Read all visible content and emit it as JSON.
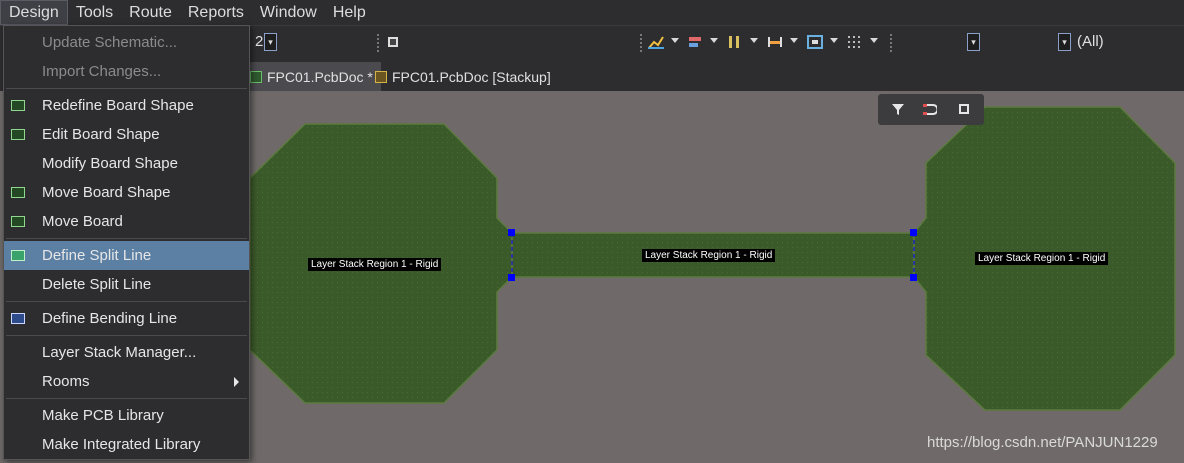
{
  "menubar": {
    "items": [
      "Design",
      "Tools",
      "Route",
      "Reports",
      "Window",
      "Help"
    ]
  },
  "design_menu": {
    "items": [
      {
        "label": "Update Schematic...",
        "enabled": false,
        "icon": null
      },
      {
        "label": "Import Changes...",
        "enabled": false,
        "icon": null
      },
      {
        "label": "Redefine Board Shape",
        "enabled": true,
        "icon": "board-shape-icon"
      },
      {
        "label": "Edit Board Shape",
        "enabled": true,
        "icon": "edit-board-icon"
      },
      {
        "label": "Modify Board Shape",
        "enabled": true,
        "icon": null
      },
      {
        "label": "Move Board Shape",
        "enabled": true,
        "icon": "move-board-shape-icon"
      },
      {
        "label": "Move Board",
        "enabled": true,
        "icon": "move-board-icon"
      },
      {
        "label": "Define Split Line",
        "enabled": true,
        "icon": "split-line-icon",
        "highlighted": true
      },
      {
        "label": "Delete Split Line",
        "enabled": true,
        "icon": null
      },
      {
        "label": "Define Bending Line",
        "enabled": true,
        "icon": "bending-line-icon"
      },
      {
        "label": "Layer Stack Manager...",
        "enabled": true,
        "icon": null
      },
      {
        "label": "Rooms",
        "enabled": true,
        "icon": null,
        "submenu": true
      },
      {
        "label": "Make PCB Library",
        "enabled": true,
        "icon": null
      },
      {
        "label": "Make Integrated Library",
        "enabled": true,
        "icon": null
      }
    ]
  },
  "toolbar": {
    "zoom_value": "2",
    "filter_value": "(All)"
  },
  "tabs": [
    {
      "label": "FPC01.PcbDoc *",
      "active": true
    },
    {
      "label": "FPC01.PcbDoc [Stackup]",
      "active": false
    }
  ],
  "board": {
    "region_labels": [
      "Layer Stack Region 1 - Rigid",
      "Layer Stack Region 1 - Rigid",
      "Layer Stack Region 1 - Rigid"
    ],
    "fill_color": "#3b5a2a",
    "outline_color": "#5c7a3e",
    "split_marker_color": "#0000ff"
  },
  "watermark": "https://blog.csdn.net/PANJUN1229"
}
